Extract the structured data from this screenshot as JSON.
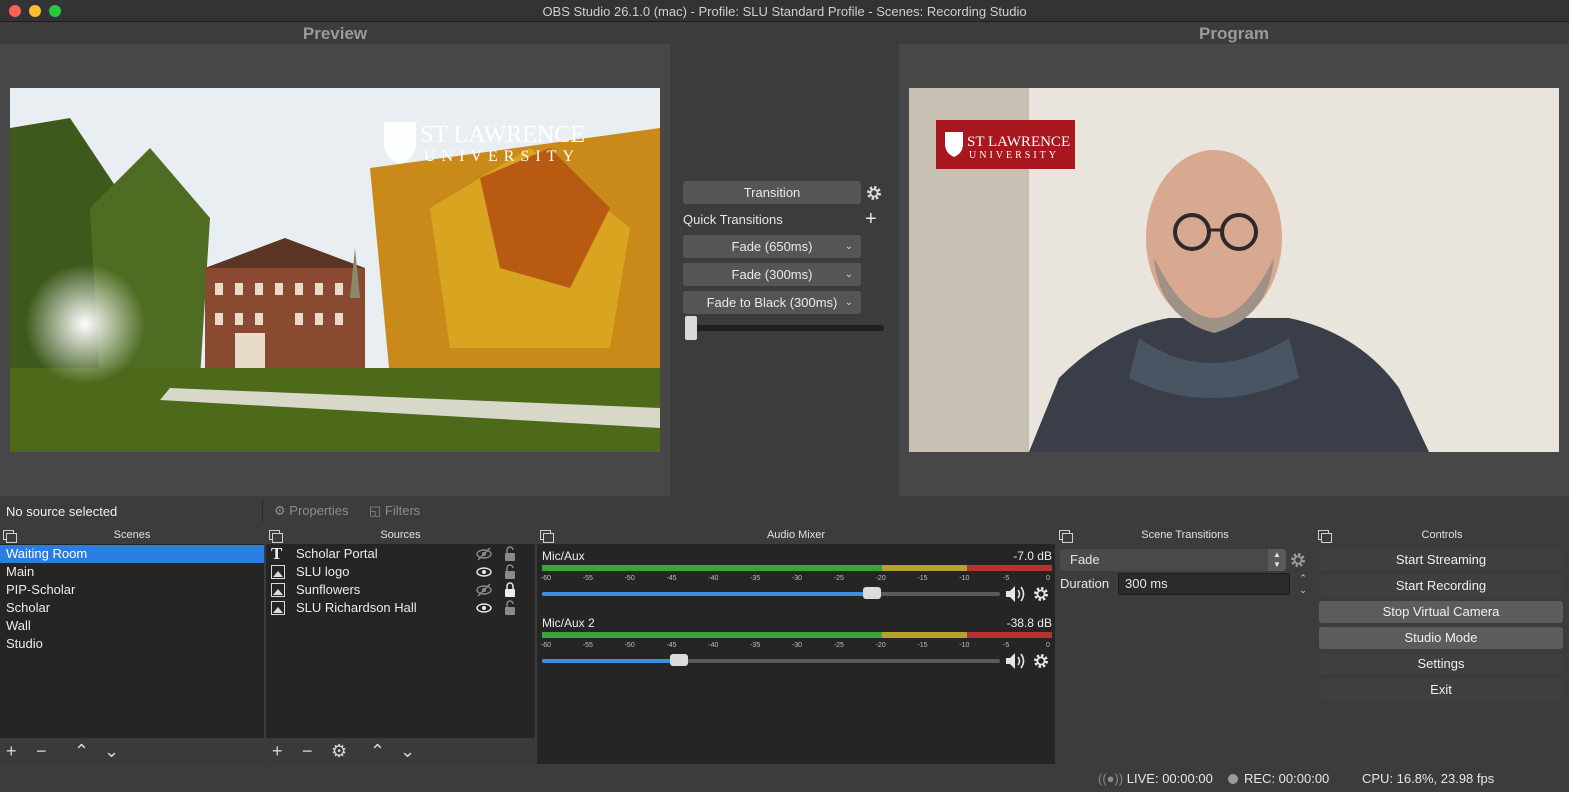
{
  "window": {
    "title": "OBS Studio 26.1.0 (mac) - Profile: SLU Standard Profile - Scenes: Recording Studio"
  },
  "preview": {
    "label": "Preview",
    "logo_line1": "ST LAWRENCE",
    "logo_line2": "UNIVERSITY"
  },
  "program": {
    "label": "Program",
    "logo_line1": "ST LAWRENCE",
    "logo_line2": "UNIVERSITY"
  },
  "transition_panel": {
    "transition_label": "Transition",
    "quick_transitions_label": "Quick Transitions",
    "quick_transitions": [
      "Fade (650ms)",
      "Fade (300ms)",
      "Fade to Black (300ms)"
    ]
  },
  "source_bar": {
    "status": "No source selected",
    "properties_label": "Properties",
    "filters_label": "Filters"
  },
  "scenes": {
    "title": "Scenes",
    "items": [
      "Waiting Room",
      "Main",
      "PIP-Scholar",
      "Scholar",
      "Wall",
      "Studio"
    ],
    "selected": "Waiting Room"
  },
  "sources": {
    "title": "Sources",
    "items": [
      {
        "name": "Scholar Portal",
        "type": "text-icon",
        "visible": false,
        "locked": false
      },
      {
        "name": "SLU logo",
        "type": "image-icon",
        "visible": true,
        "locked": false
      },
      {
        "name": "Sunflowers",
        "type": "image-icon",
        "visible": false,
        "locked": true
      },
      {
        "name": "SLU Richardson Hall",
        "type": "image-icon",
        "visible": true,
        "locked": false
      }
    ]
  },
  "audio_mixer": {
    "title": "Audio Mixer",
    "tick_labels": [
      "-60",
      "-55",
      "-50",
      "-45",
      "-40",
      "-35",
      "-30",
      "-25",
      "-20",
      "-15",
      "-10",
      "-5",
      "0"
    ],
    "channels": [
      {
        "name": "Mic/Aux",
        "level": "-7.0 dB",
        "volume": 0.72
      },
      {
        "name": "Mic/Aux 2",
        "level": "-38.8 dB",
        "volume": 0.3
      }
    ]
  },
  "scene_transitions": {
    "title": "Scene Transitions",
    "selected": "Fade",
    "duration_label": "Duration",
    "duration_value": "300 ms"
  },
  "controls": {
    "title": "Controls",
    "buttons": [
      {
        "label": "Start Streaming",
        "active": false
      },
      {
        "label": "Start Recording",
        "active": false
      },
      {
        "label": "Stop Virtual Camera",
        "active": true
      },
      {
        "label": "Studio Mode",
        "active": true
      },
      {
        "label": "Settings",
        "active": false
      },
      {
        "label": "Exit",
        "active": false
      }
    ]
  },
  "status_bar": {
    "live": "LIVE: 00:00:00",
    "rec": "REC: 00:00:00",
    "cpu": "CPU: 16.8%, 23.98 fps"
  },
  "colors": {
    "selection": "#2a7de1",
    "meter_green": "#3aa63a",
    "meter_yellow": "#b5a22e",
    "meter_red": "#b83232",
    "volume_fill": "#3c8fe0"
  }
}
